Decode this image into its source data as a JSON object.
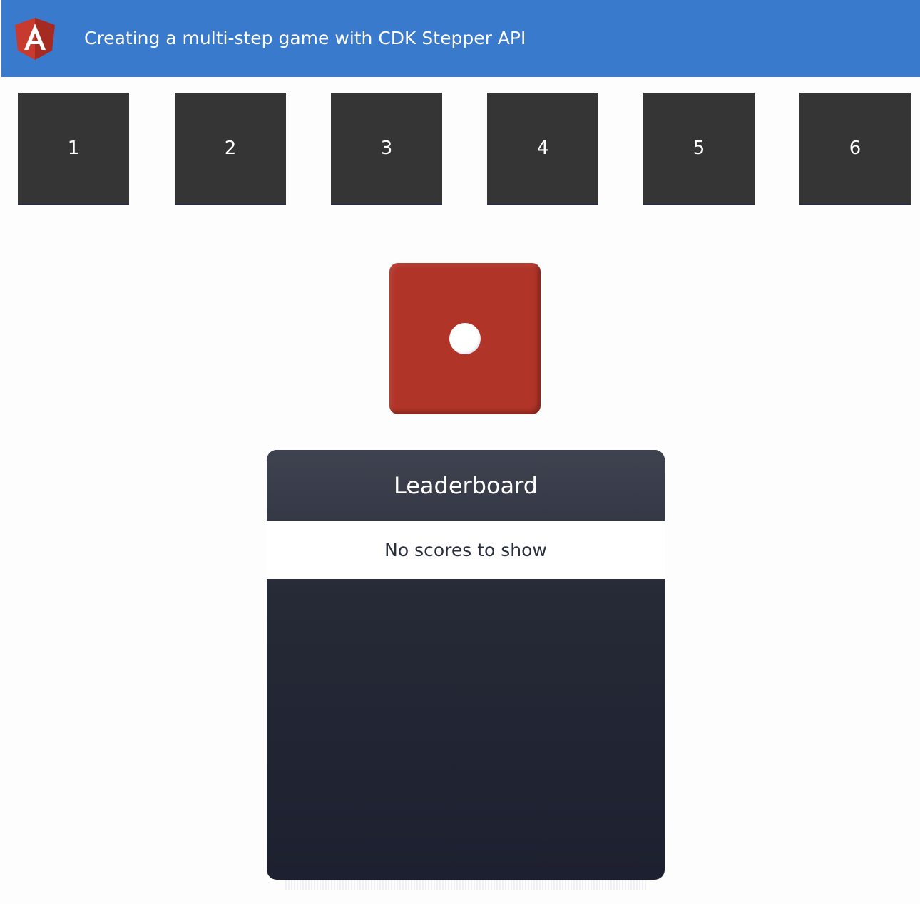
{
  "header": {
    "logo": "angular-logo",
    "title": "Creating a multi-step game with CDK Stepper API"
  },
  "steps": [
    {
      "label": "1"
    },
    {
      "label": "2"
    },
    {
      "label": "3"
    },
    {
      "label": "4"
    },
    {
      "label": "5"
    },
    {
      "label": "6"
    }
  ],
  "die": {
    "face_value": 1,
    "color": "#b13428"
  },
  "leaderboard": {
    "title": "Leaderboard",
    "empty_message": "No scores to show"
  },
  "colors": {
    "header_bg": "#3a7acc",
    "step_bg": "#353535",
    "leaderboard_bg": "#262a36"
  }
}
